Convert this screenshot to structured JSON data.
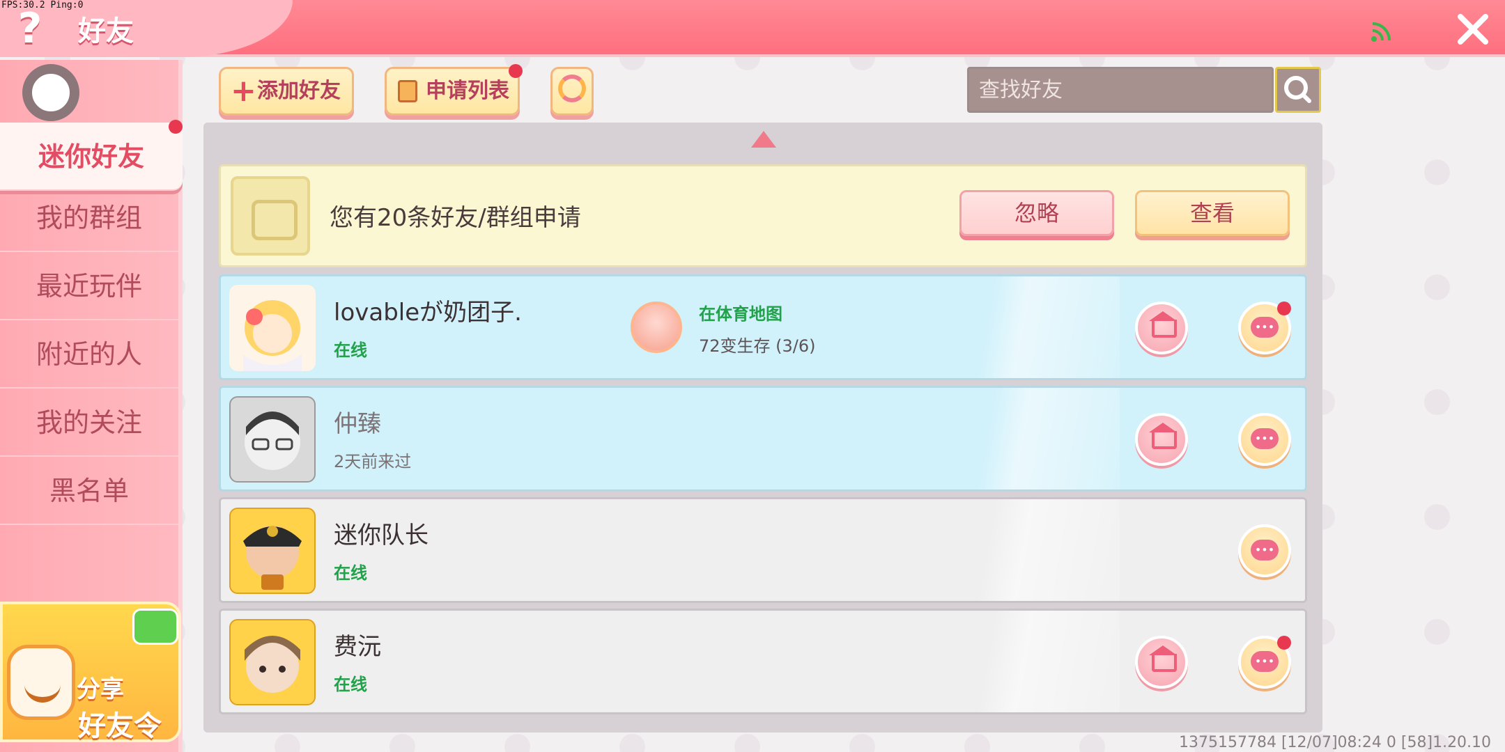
{
  "debug": {
    "fps_text": "FPS:30.2 Ping:0"
  },
  "header": {
    "title": "好友",
    "help_icon": "question-icon",
    "signal_icon": "signal-icon",
    "close_icon": "close-icon"
  },
  "sidebar": {
    "items": [
      {
        "label": "迷你好友",
        "active": true
      },
      {
        "label": "我的群组"
      },
      {
        "label": "最近玩伴"
      },
      {
        "label": "附近的人"
      },
      {
        "label": "我的关注"
      },
      {
        "label": "黑名单"
      }
    ],
    "share": {
      "line1": "分享",
      "line2": "好友令"
    }
  },
  "toolbar": {
    "add_friend_label": "添加好友",
    "apply_list_label": "申请列表",
    "search": {
      "placeholder": "查找好友",
      "value": ""
    }
  },
  "notice": {
    "text": "您有20条好友/群组申请",
    "ignore_label": "忽略",
    "view_label": "查看"
  },
  "friends": [
    {
      "name": "lovableが奶团子.",
      "status": "在线",
      "online": true,
      "game_map": "在体育地图",
      "game_mode": "72变生存 (3/6)",
      "has_home": true,
      "chat_unread": true
    },
    {
      "name": "仲臻",
      "status": "2天前来过",
      "online": false,
      "has_home": true,
      "chat_unread": false
    },
    {
      "name": "迷你队长",
      "status": "在线",
      "online": true,
      "has_home": false,
      "chat_unread": false
    },
    {
      "name": "费沅",
      "status": "在线",
      "online": true,
      "has_home": true,
      "chat_unread": true
    }
  ],
  "footer": {
    "text": "1375157784    [12/07]08:24 0  [58]1.20.10"
  },
  "colors": {
    "accent": "#ff6f7f",
    "online": "#21a24a",
    "unread_dot": "#e8384f"
  }
}
